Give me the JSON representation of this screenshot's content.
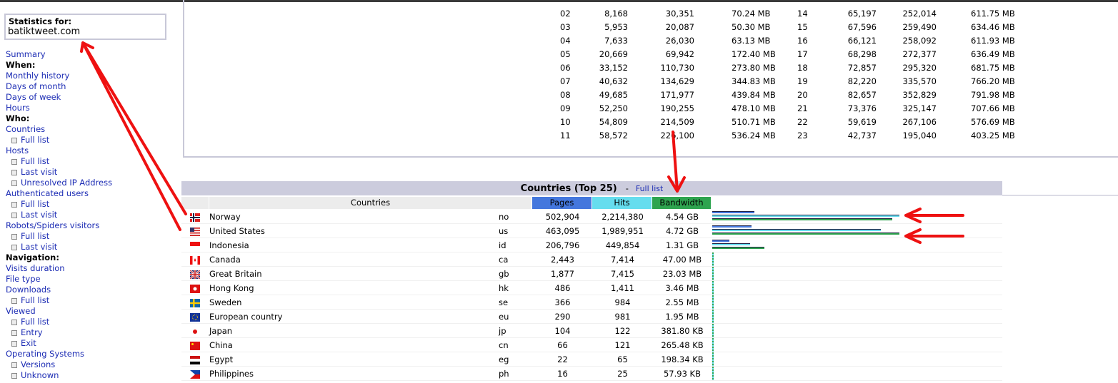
{
  "sidebar": {
    "stats_label": "Statistics for:",
    "site": "batiktweet.com",
    "menu": [
      {
        "label": "Summary",
        "type": "link"
      },
      {
        "label": "When:",
        "type": "head"
      },
      {
        "label": "Monthly history",
        "type": "link"
      },
      {
        "label": "Days of month",
        "type": "link"
      },
      {
        "label": "Days of week",
        "type": "link"
      },
      {
        "label": "Hours",
        "type": "link"
      },
      {
        "label": "Who:",
        "type": "head"
      },
      {
        "label": "Countries",
        "type": "link"
      },
      {
        "label": "Full list",
        "type": "sub"
      },
      {
        "label": "Hosts",
        "type": "link"
      },
      {
        "label": "Full list",
        "type": "sub"
      },
      {
        "label": "Last visit",
        "type": "sub"
      },
      {
        "label": "Unresolved IP Address",
        "type": "sub"
      },
      {
        "label": "Authenticated users",
        "type": "link"
      },
      {
        "label": "Full list",
        "type": "sub"
      },
      {
        "label": "Last visit",
        "type": "sub"
      },
      {
        "label": "Robots/Spiders visitors",
        "type": "link"
      },
      {
        "label": "Full list",
        "type": "sub"
      },
      {
        "label": "Last visit",
        "type": "sub"
      },
      {
        "label": "Navigation:",
        "type": "head"
      },
      {
        "label": "Visits duration",
        "type": "link"
      },
      {
        "label": "File type",
        "type": "link"
      },
      {
        "label": "Downloads",
        "type": "link"
      },
      {
        "label": "Full list",
        "type": "sub"
      },
      {
        "label": "Viewed",
        "type": "link"
      },
      {
        "label": "Full list",
        "type": "sub"
      },
      {
        "label": "Entry",
        "type": "sub"
      },
      {
        "label": "Exit",
        "type": "sub"
      },
      {
        "label": "Operating Systems",
        "type": "link"
      },
      {
        "label": "Versions",
        "type": "sub"
      },
      {
        "label": "Unknown",
        "type": "sub"
      }
    ]
  },
  "hours": {
    "rows": [
      {
        "h1": "02",
        "p1": "8,168",
        "t1": "30,351",
        "b1": "70.24 MB",
        "h2": "14",
        "p2": "65,197",
        "t2": "252,014",
        "b2": "611.75 MB"
      },
      {
        "h1": "03",
        "p1": "5,953",
        "t1": "20,087",
        "b1": "50.30 MB",
        "h2": "15",
        "p2": "67,596",
        "t2": "259,490",
        "b2": "634.46 MB"
      },
      {
        "h1": "04",
        "p1": "7,633",
        "t1": "26,030",
        "b1": "63.13 MB",
        "h2": "16",
        "p2": "66,121",
        "t2": "258,092",
        "b2": "611.93 MB"
      },
      {
        "h1": "05",
        "p1": "20,669",
        "t1": "69,942",
        "b1": "172.40 MB",
        "h2": "17",
        "p2": "68,298",
        "t2": "272,377",
        "b2": "636.49 MB"
      },
      {
        "h1": "06",
        "p1": "33,152",
        "t1": "110,730",
        "b1": "273.80 MB",
        "h2": "18",
        "p2": "72,857",
        "t2": "295,320",
        "b2": "681.75 MB"
      },
      {
        "h1": "07",
        "p1": "40,632",
        "t1": "134,629",
        "b1": "344.83 MB",
        "h2": "19",
        "p2": "82,220",
        "t2": "335,570",
        "b2": "766.20 MB"
      },
      {
        "h1": "08",
        "p1": "49,685",
        "t1": "171,977",
        "b1": "439.84 MB",
        "h2": "20",
        "p2": "82,657",
        "t2": "352,829",
        "b2": "791.98 MB"
      },
      {
        "h1": "09",
        "p1": "52,250",
        "t1": "190,255",
        "b1": "478.10 MB",
        "h2": "21",
        "p2": "73,376",
        "t2": "325,147",
        "b2": "707.66 MB"
      },
      {
        "h1": "10",
        "p1": "54,809",
        "t1": "214,509",
        "b1": "510.71 MB",
        "h2": "22",
        "p2": "59,619",
        "t2": "267,106",
        "b2": "576.69 MB"
      },
      {
        "h1": "11",
        "p1": "58,572",
        "t1": "226,100",
        "b1": "536.24 MB",
        "h2": "23",
        "p2": "42,737",
        "t2": "195,040",
        "b2": "403.25 MB"
      }
    ]
  },
  "countries": {
    "title": "Countries (Top 25)",
    "separator": "-",
    "full_list": "Full list",
    "headers": {
      "countries": "Countries",
      "pages": "Pages",
      "hits": "Hits",
      "bandwidth": "Bandwidth"
    },
    "colors": {
      "pages": "#4477dd",
      "hits": "#66ddee",
      "bandwidth": "#2ea44f"
    },
    "rows": [
      {
        "name": "Norway",
        "code": "no",
        "pages": "502,904",
        "hits": "2,214,380",
        "bandwidth": "4.54 GB",
        "flag": "norway-flag"
      },
      {
        "name": "United States",
        "code": "us",
        "pages": "463,095",
        "hits": "1,989,951",
        "bandwidth": "4.72 GB",
        "flag": "us-flag"
      },
      {
        "name": "Indonesia",
        "code": "id",
        "pages": "206,796",
        "hits": "449,854",
        "bandwidth": "1.31 GB",
        "flag": "indonesia-flag"
      },
      {
        "name": "Canada",
        "code": "ca",
        "pages": "2,443",
        "hits": "7,414",
        "bandwidth": "47.00 MB",
        "flag": "canada-flag"
      },
      {
        "name": "Great Britain",
        "code": "gb",
        "pages": "1,877",
        "hits": "7,415",
        "bandwidth": "23.03 MB",
        "flag": "uk-flag"
      },
      {
        "name": "Hong Kong",
        "code": "hk",
        "pages": "486",
        "hits": "1,411",
        "bandwidth": "3.46 MB",
        "flag": "hongkong-flag"
      },
      {
        "name": "Sweden",
        "code": "se",
        "pages": "366",
        "hits": "984",
        "bandwidth": "2.55 MB",
        "flag": "sweden-flag"
      },
      {
        "name": "European country",
        "code": "eu",
        "pages": "290",
        "hits": "981",
        "bandwidth": "1.95 MB",
        "flag": "eu-flag"
      },
      {
        "name": "Japan",
        "code": "jp",
        "pages": "104",
        "hits": "122",
        "bandwidth": "381.80 KB",
        "flag": "japan-flag"
      },
      {
        "name": "China",
        "code": "cn",
        "pages": "66",
        "hits": "121",
        "bandwidth": "265.48 KB",
        "flag": "china-flag"
      },
      {
        "name": "Egypt",
        "code": "eg",
        "pages": "22",
        "hits": "65",
        "bandwidth": "198.34 KB",
        "flag": "egypt-flag"
      },
      {
        "name": "Philippines",
        "code": "ph",
        "pages": "16",
        "hits": "25",
        "bandwidth": "57.93 KB",
        "flag": "philippines-flag"
      }
    ],
    "bar_fractions": [
      {
        "pages": 0.227,
        "hits": 1.0,
        "bandwidth": 0.962
      },
      {
        "pages": 0.209,
        "hits": 0.899,
        "bandwidth": 1.0
      },
      {
        "pages": 0.093,
        "hits": 0.203,
        "bandwidth": 0.278
      }
    ]
  },
  "annotations": {
    "color": "#ee1111"
  }
}
